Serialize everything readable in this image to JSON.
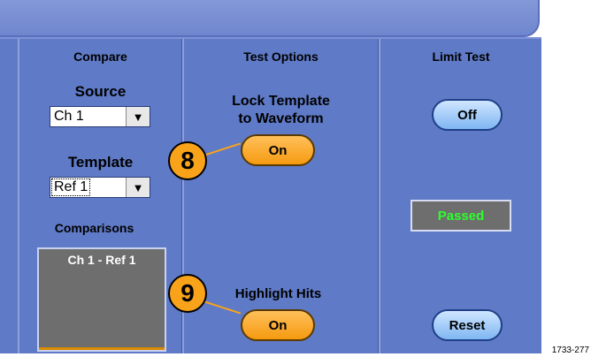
{
  "compare": {
    "header": "Compare",
    "source_label": "Source",
    "source_value": "Ch 1",
    "template_label": "Template",
    "template_value": "Ref 1",
    "comparisons_label": "Comparisons",
    "comparisons_items": [
      "Ch 1 - Ref 1"
    ]
  },
  "test_options": {
    "header": "Test Options",
    "lock_label_line1": "Lock Template",
    "lock_label_line2": "to Waveform",
    "lock_button": "On",
    "highlight_label": "Highlight Hits",
    "highlight_button": "On"
  },
  "limit_test": {
    "header": "Limit Test",
    "toggle_button": "Off",
    "status": "Passed",
    "reset_button": "Reset"
  },
  "callouts": {
    "first": "8",
    "second": "9"
  },
  "figure_id": "1733-277",
  "icons": {
    "dropdown_arrow": "triangle-down"
  }
}
